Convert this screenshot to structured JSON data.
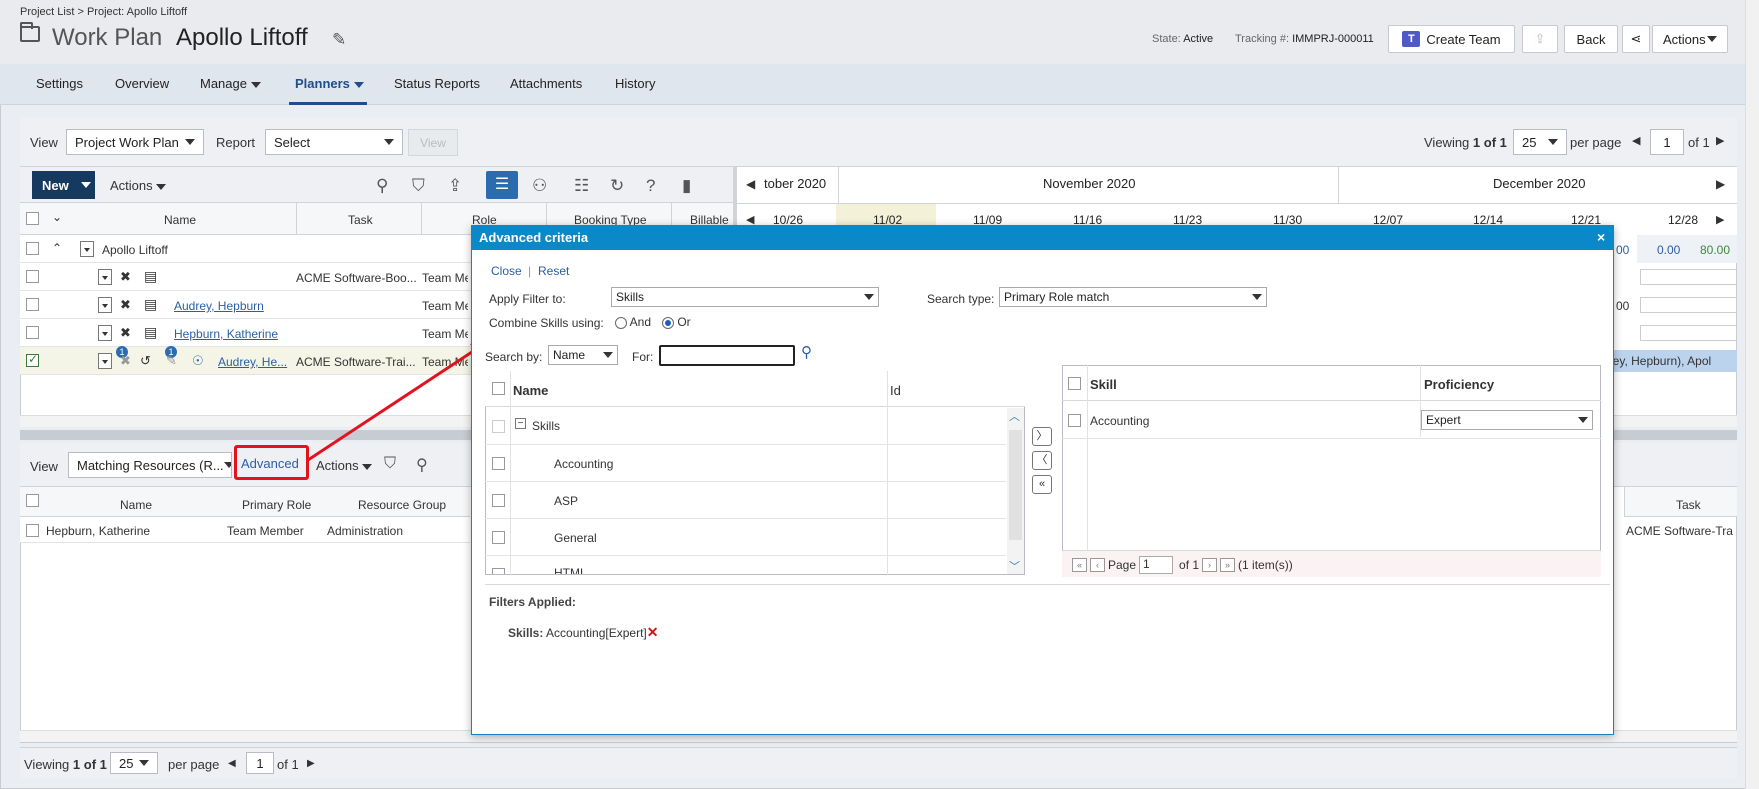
{
  "breadcrumb": "Project List > Project: Apollo Liftoff",
  "header": {
    "title_prefix": "Work Plan",
    "title_name": "Apollo Liftoff",
    "state_label": "State:",
    "state_value": "Active",
    "tracking_label": "Tracking #:",
    "tracking_value": "IMMPRJ-000011",
    "create_team": "Create Team",
    "teams_icon_letter": "T",
    "back": "Back",
    "actions": "Actions"
  },
  "tabs": [
    "Settings",
    "Overview",
    "Manage",
    "Planners",
    "Status Reports",
    "Attachments",
    "History"
  ],
  "planner": {
    "view_label": "View",
    "view_value": "Project Work Plan",
    "report_label": "Report",
    "report_value": "Select",
    "view_button": "View",
    "viewing": "Viewing",
    "viewing_range": "1 of 1",
    "per_page_value": "25",
    "per_page": "per page",
    "page": "1",
    "of_pages": "of 1",
    "new": "New",
    "actions": "Actions",
    "columns": [
      "Name",
      "Task",
      "Role",
      "Booking Type",
      "Billable"
    ],
    "rows": [
      {
        "name": "Apollo Liftoff",
        "task": "",
        "role": ""
      },
      {
        "name": "",
        "task": "ACME Software-Boo...",
        "role": "Team Me"
      },
      {
        "name": "Audrey, Hepburn",
        "task": "",
        "role": "Team Me"
      },
      {
        "name": "Hepburn, Katherine",
        "task": "",
        "role": "Team Me"
      },
      {
        "name": "Audrey, He...",
        "task": "ACME Software-Trai...",
        "role": "Team Me"
      }
    ],
    "badge": "1"
  },
  "timeline": {
    "months": [
      "tober 2020",
      "November 2020",
      "December 2020"
    ],
    "weeks": [
      "10/26",
      "11/02",
      "11/09",
      "11/16",
      "11/23",
      "11/30",
      "12/07",
      "12/14",
      "12/21",
      "12/28"
    ],
    "cells": {
      "v1": "00",
      "v2": "0.00",
      "v3": "80.00",
      "v4": "00",
      "v5": "drey, Hepburn), Apol"
    }
  },
  "resources": {
    "view_label": "View",
    "view_value": "Matching Resources (R...",
    "advanced": "Advanced",
    "actions": "Actions",
    "columns": [
      "Name",
      "Primary Role",
      "Resource Group"
    ],
    "task_col": "Task",
    "row": {
      "name": "Hepburn, Katherine",
      "role": "Team Member",
      "group": "Administration",
      "task": "ACME Software-Tra"
    }
  },
  "footer": {
    "viewing": "Viewing",
    "range": "1 of 1",
    "per_page_value": "25",
    "per_page": "per page",
    "page": "1",
    "of_pages": "of 1"
  },
  "modal": {
    "title": "Advanced criteria",
    "close_x": "×",
    "close": "Close",
    "separator": "|",
    "reset": "Reset",
    "apply_filter_label": "Apply Filter to:",
    "apply_filter_value": "Skills",
    "search_type_label": "Search type:",
    "search_type_value": "Primary Role match",
    "combine_label": "Combine Skills using:",
    "and": "And",
    "or": "Or",
    "search_by_label": "Search by:",
    "search_by_value": "Name",
    "for_label": "For:",
    "tree_columns": [
      "Name",
      "Id"
    ],
    "tree_root": "Skills",
    "tree_items": [
      "Accounting",
      "ASP",
      "General",
      "HTML"
    ],
    "skill_columns": [
      "Skill",
      "Proficiency"
    ],
    "selected_skill": "Accounting",
    "proficiency": "Expert",
    "pager_page": "Page",
    "pager_value": "1",
    "pager_of": "of 1",
    "pager_items": "(1 item(s))",
    "filters_applied": "Filters Applied:",
    "filter_key": "Skills:",
    "filter_value": "Accounting[Expert]",
    "remove_x": "✕"
  },
  "colors": {
    "accent": "#0b88c7",
    "nav_dark": "#163a5f",
    "annotation_red": "#e0141e",
    "link": "#2a5fa5"
  }
}
